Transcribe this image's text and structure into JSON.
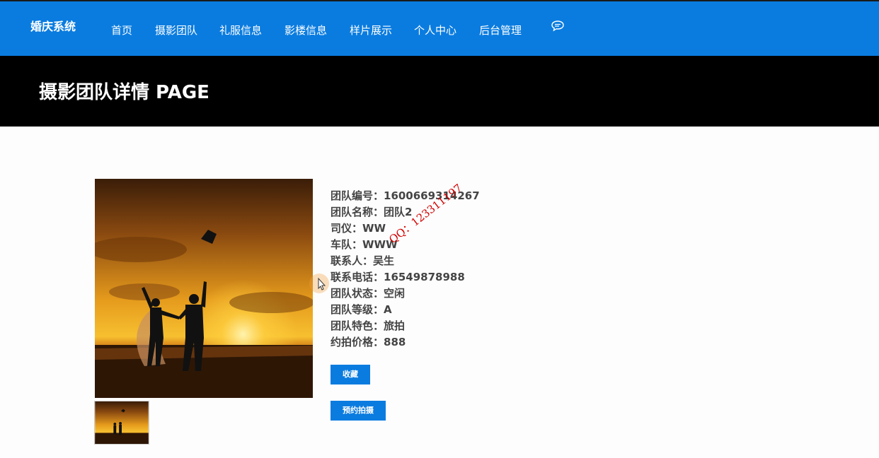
{
  "nav": {
    "brand": "婚庆系统",
    "items": [
      "首页",
      "摄影团队",
      "礼服信息",
      "影楼信息",
      "样片展示",
      "个人中心",
      "后台管理"
    ]
  },
  "hero": {
    "title": "摄影团队详情 PAGE"
  },
  "team": {
    "lines": [
      "团队编号：1600669314267",
      "团队名称：团队2",
      "司仪：WW",
      "车队：WWW",
      "联系人：吴生",
      "联系电话：16549878988",
      "团队状态：空闲",
      "团队等级：A",
      "团队特色：旅拍",
      "约拍价格：888"
    ]
  },
  "buttons": {
    "favorite": "收藏",
    "book": "预约拍摄"
  },
  "watermark": "QQ：123311197",
  "colors": {
    "primary": "#0a7ce0",
    "hero_bg": "#000000",
    "text": "#444444"
  }
}
